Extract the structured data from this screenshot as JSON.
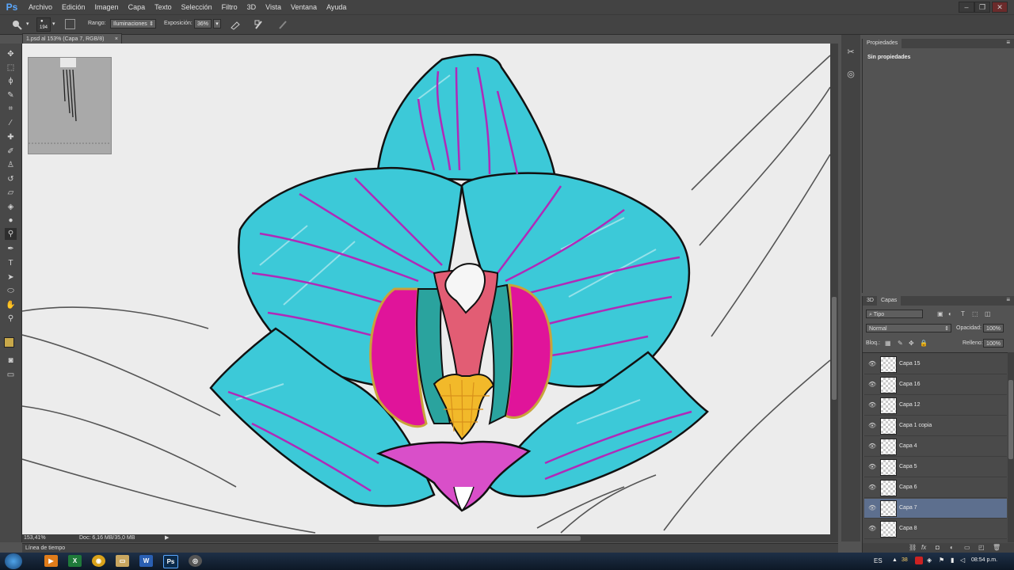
{
  "app": {
    "logo": "Ps"
  },
  "menu": [
    "Archivo",
    "Edición",
    "Imagen",
    "Capa",
    "Texto",
    "Selección",
    "Filtro",
    "3D",
    "Vista",
    "Ventana",
    "Ayuda"
  ],
  "window_controls": {
    "minimize": "–",
    "restore": "❐",
    "close": "✕"
  },
  "options": {
    "brush_size": "194",
    "range_label": "Rango:",
    "range_value": "Iluminaciones",
    "exposure_label": "Exposición:",
    "exposure_value": "36%"
  },
  "document_tab": {
    "title": "1.psd al 153% (Capa 7, RGB/8)",
    "close": "×"
  },
  "status": {
    "zoom": "153,41%",
    "doc": "Doc: 6,16 MB/35,0 MB"
  },
  "timeline": {
    "label": "Línea de tiempo"
  },
  "properties": {
    "tab": "Propiedades",
    "content": "Sin propiedades"
  },
  "layers_panel": {
    "tabs": [
      "3D",
      "Capas"
    ],
    "filter": "Tipo",
    "blend_mode": "Normal",
    "opacity_label": "Opacidad:",
    "opacity_value": "100%",
    "lock_label": "Bloq.:",
    "fill_label": "Relleno:",
    "fill_value": "100%",
    "layers": [
      {
        "name": "Capa 15",
        "selected": false
      },
      {
        "name": "Capa 16",
        "selected": false
      },
      {
        "name": "Capa 12",
        "selected": false
      },
      {
        "name": "Capa 1 copia",
        "selected": false
      },
      {
        "name": "Capa 4",
        "selected": false
      },
      {
        "name": "Capa 5",
        "selected": false
      },
      {
        "name": "Capa 6",
        "selected": false
      },
      {
        "name": "Capa 7",
        "selected": true
      },
      {
        "name": "Capa 8",
        "selected": false
      }
    ]
  },
  "taskbar": {
    "lang": "ES",
    "time": "08:54 p.m.",
    "badge": "38"
  },
  "colors": {
    "foreground": "#c8a84a",
    "background": "#ffffff",
    "petal": "#3cc9d8",
    "vein": "#b02ab8",
    "lip": "#e0149a",
    "column": "#f2b92a"
  }
}
